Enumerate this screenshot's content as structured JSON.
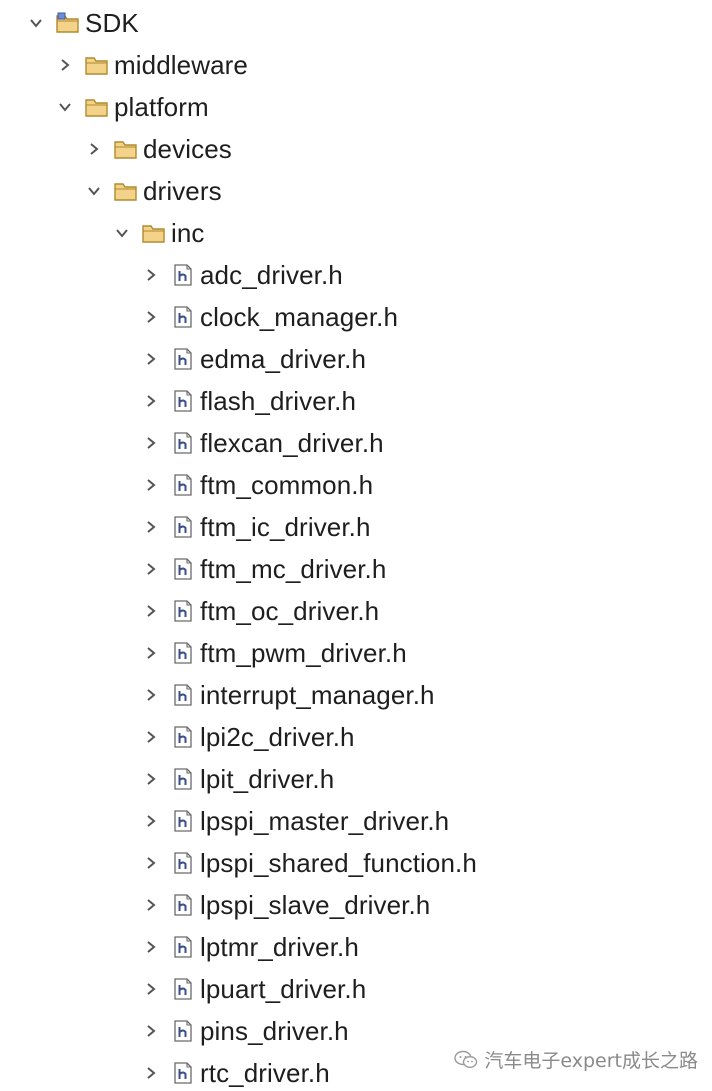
{
  "tree": {
    "project": {
      "label": "SDK",
      "icon": "project-folder-icon",
      "expanded": true
    },
    "folders": {
      "middleware": {
        "label": "middleware",
        "icon": "folder-icon",
        "expanded": false
      },
      "platform": {
        "label": "platform",
        "icon": "folder-icon",
        "expanded": true
      },
      "devices": {
        "label": "devices",
        "icon": "folder-icon",
        "expanded": false
      },
      "drivers": {
        "label": "drivers",
        "icon": "folder-icon",
        "expanded": true
      },
      "inc": {
        "label": "inc",
        "icon": "folder-icon",
        "expanded": true
      }
    },
    "files": [
      {
        "label": "adc_driver.h",
        "icon": "header-file-icon"
      },
      {
        "label": "clock_manager.h",
        "icon": "header-file-icon"
      },
      {
        "label": "edma_driver.h",
        "icon": "header-file-icon"
      },
      {
        "label": "flash_driver.h",
        "icon": "header-file-icon"
      },
      {
        "label": "flexcan_driver.h",
        "icon": "header-file-icon"
      },
      {
        "label": "ftm_common.h",
        "icon": "header-file-icon"
      },
      {
        "label": "ftm_ic_driver.h",
        "icon": "header-file-icon"
      },
      {
        "label": "ftm_mc_driver.h",
        "icon": "header-file-icon"
      },
      {
        "label": "ftm_oc_driver.h",
        "icon": "header-file-icon"
      },
      {
        "label": "ftm_pwm_driver.h",
        "icon": "header-file-icon"
      },
      {
        "label": "interrupt_manager.h",
        "icon": "header-file-icon"
      },
      {
        "label": "lpi2c_driver.h",
        "icon": "header-file-icon"
      },
      {
        "label": "lpit_driver.h",
        "icon": "header-file-icon"
      },
      {
        "label": "lpspi_master_driver.h",
        "icon": "header-file-icon"
      },
      {
        "label": "lpspi_shared_function.h",
        "icon": "header-file-icon"
      },
      {
        "label": "lpspi_slave_driver.h",
        "icon": "header-file-icon"
      },
      {
        "label": "lptmr_driver.h",
        "icon": "header-file-icon"
      },
      {
        "label": "lpuart_driver.h",
        "icon": "header-file-icon"
      },
      {
        "label": "pins_driver.h",
        "icon": "header-file-icon"
      },
      {
        "label": "rtc_driver.h",
        "icon": "header-file-icon"
      }
    ]
  },
  "watermark": {
    "text": "汽车电子expert成长之路",
    "icon": "wechat-icon"
  },
  "colors": {
    "text": "#1e1e1e",
    "chevron": "#555555",
    "folder_fill": "#f3d38a",
    "folder_stroke": "#b08a2e",
    "file_letter": "#3a4f8c",
    "watermark": "#8a8a8a"
  }
}
